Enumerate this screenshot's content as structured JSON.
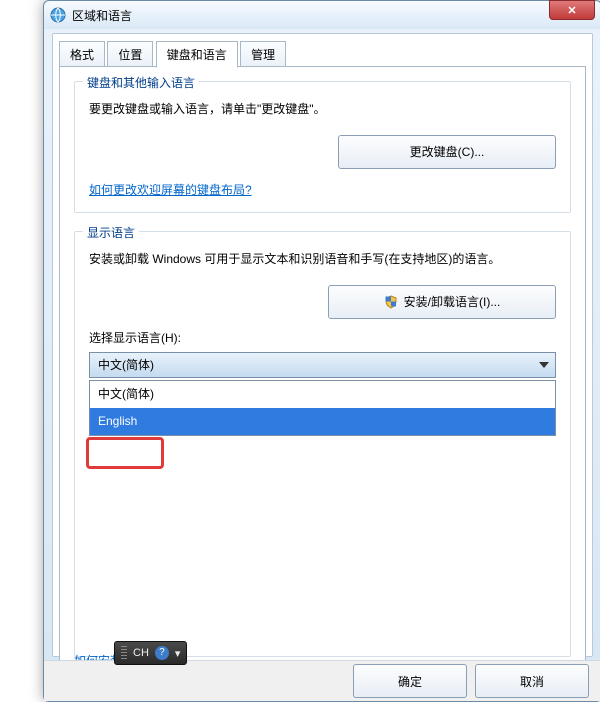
{
  "window": {
    "title": "区域和语言",
    "close_symbol": "✕"
  },
  "tabs": {
    "items": [
      {
        "label": "格式"
      },
      {
        "label": "位置"
      },
      {
        "label": "键盘和语言"
      },
      {
        "label": "管理"
      }
    ],
    "active_index": 2
  },
  "keyboard_group": {
    "legend": "键盘和其他输入语言",
    "text": "要更改键盘或输入语言，请单击\"更改键盘\"。",
    "button": "更改键盘(C)...",
    "link": "如何更改欢迎屏幕的键盘布局?"
  },
  "display_group": {
    "legend": "显示语言",
    "text": "安装或卸载 Windows 可用于显示文本和识别语音和手写(在支持地区)的语言。",
    "install_button": "安装/卸载语言(I)...",
    "select_label": "选择显示语言(H):",
    "selected": "中文(简体)",
    "options": [
      {
        "label": "中文(简体)"
      },
      {
        "label": "English"
      }
    ]
  },
  "footer_link": "如何安装其他语言?",
  "buttons": {
    "ok": "确定",
    "cancel": "取消"
  },
  "ime": {
    "lang": "CH",
    "help": "?",
    "arrow": "▾"
  }
}
